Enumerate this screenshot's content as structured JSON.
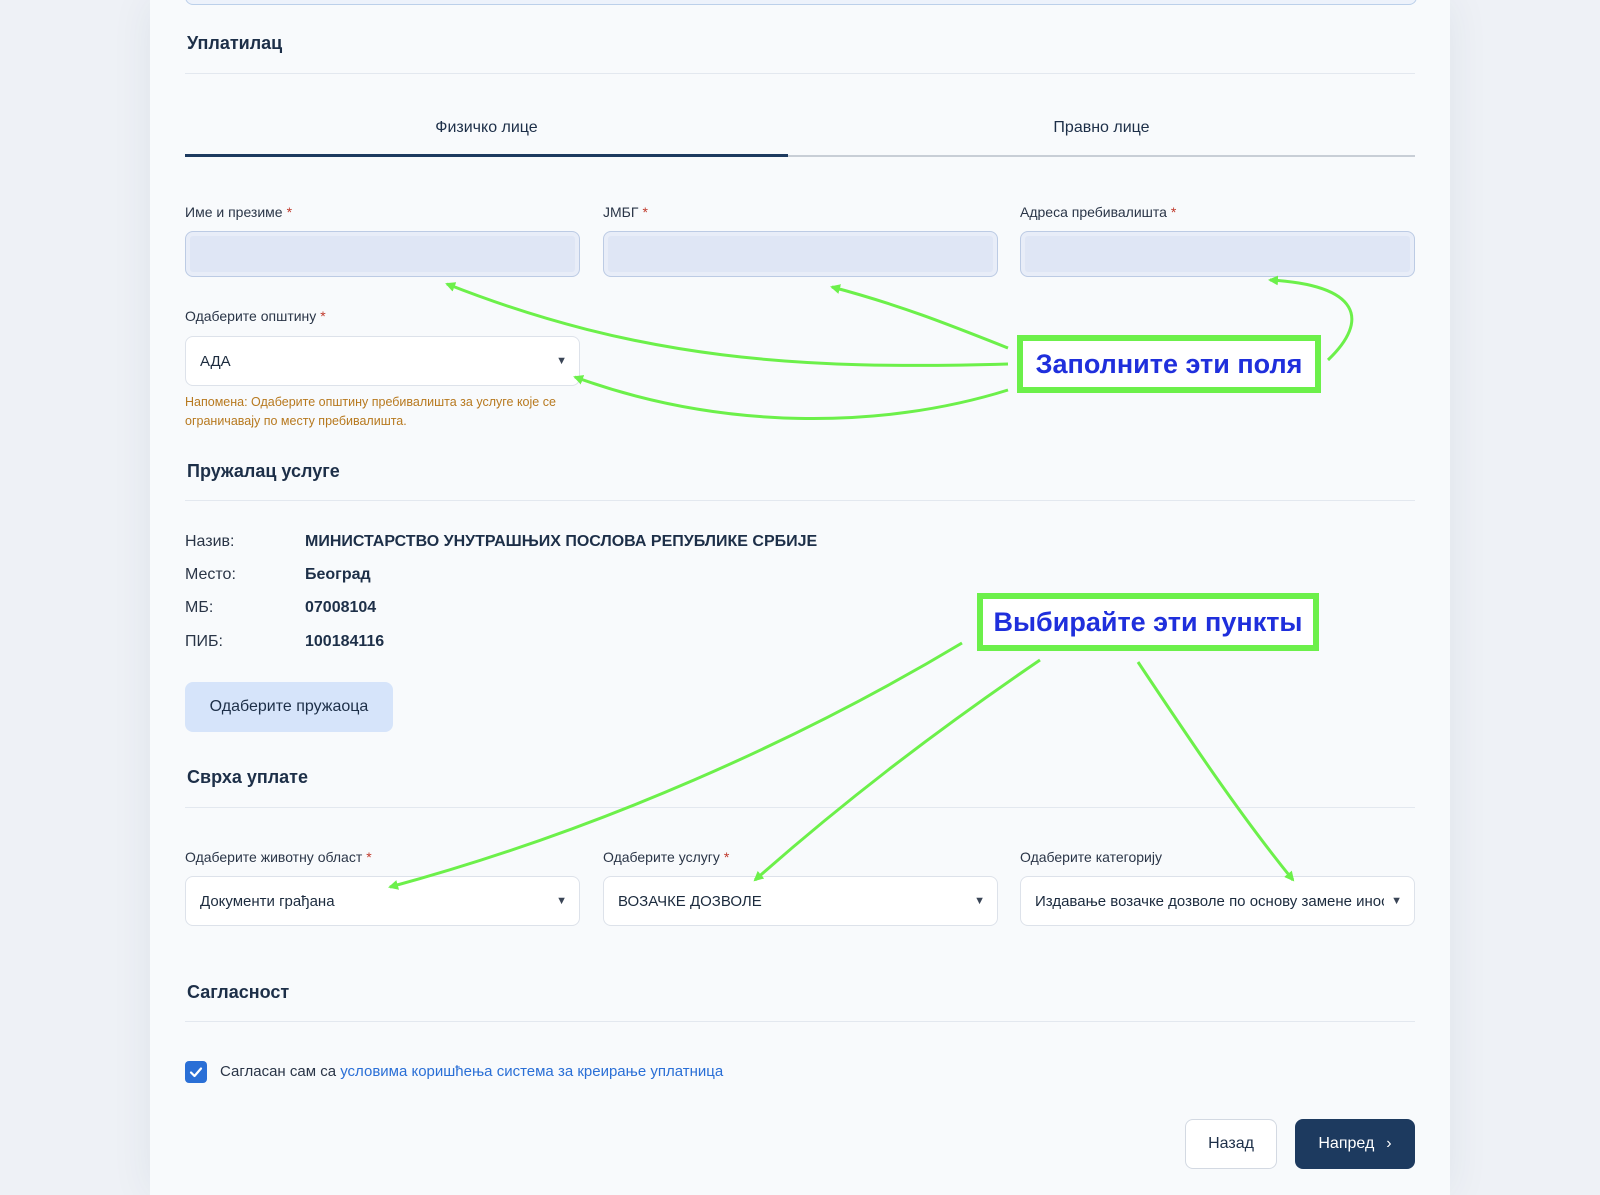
{
  "payer": {
    "title": "Уплатилац",
    "tabs": [
      {
        "label": "Физичко лице",
        "active": true
      },
      {
        "label": "Правно лице",
        "active": false
      }
    ],
    "fields": {
      "full_name": {
        "label": "Име и презиме",
        "value": ""
      },
      "jmbg": {
        "label": "ЈМБГ",
        "value": ""
      },
      "address": {
        "label": "Адреса пребивалишта",
        "value": ""
      },
      "municipality": {
        "label": "Одаберите општину",
        "value": "АДА"
      }
    },
    "required_mark": "*",
    "note": "Напомена: Одаберите општину пребивалишта за услуге које се ограничавају по месту пребивалишта."
  },
  "provider": {
    "title": "Пружалац услуге",
    "rows": [
      {
        "key": "Назив:",
        "value": "МИНИСТАРСТВО УНУТРАШЊИХ ПОСЛОВА РЕПУБЛИКЕ СРБИЈЕ"
      },
      {
        "key": "Место:",
        "value": "Београд"
      },
      {
        "key": "МБ:",
        "value": "07008104"
      },
      {
        "key": "ПИБ:",
        "value": "100184116"
      }
    ],
    "select_button": "Одаберите пружаоца"
  },
  "purpose": {
    "title": "Сврха уплате",
    "life_area": {
      "label": "Одаберите животну област",
      "value": "Документи грађана"
    },
    "service": {
      "label": "Одаберите услугу",
      "value": "ВОЗАЧКЕ ДОЗВОЛЕ"
    },
    "category": {
      "label": "Одаберите категорију",
      "value": "Издавање возачке дозволе по основу замене иностране"
    }
  },
  "consent": {
    "title": "Сагласност",
    "text": "Сагласан сам са ",
    "link": "условима коришћења система за креирање уплатница",
    "checked": true
  },
  "actions": {
    "back": "Назад",
    "next": "Напред",
    "next_icon": "›"
  },
  "annotations": {
    "fill_fields": "Заполните эти поля",
    "choose_items": "Выбирайте эти пункты",
    "color": "#6cf04a",
    "text_color": "#1f2fdc"
  },
  "colors": {
    "primary": "#1d3a5f",
    "link": "#2a6fd6",
    "required": "#c0392b",
    "note": "#b7791f"
  }
}
